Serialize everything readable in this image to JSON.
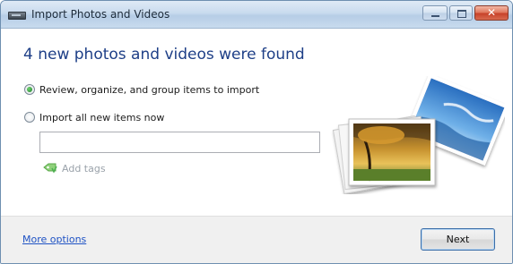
{
  "window": {
    "title": "Import Photos and Videos"
  },
  "main": {
    "heading": "4 new photos and videos were found",
    "options": [
      {
        "label": "Review, organize, and group items to import",
        "selected": true
      },
      {
        "label": "Import all new items now",
        "selected": false
      }
    ],
    "tag_input": {
      "value": "",
      "placeholder": ""
    },
    "add_tags_label": "Add tags"
  },
  "footer": {
    "more_options": "More options",
    "next_label": "Next"
  },
  "icons": {
    "app": "app-window-icon",
    "tag": "tag-icon",
    "photos": "photo-stack-illustration"
  },
  "colors": {
    "heading": "#1e3f87",
    "link": "#1e52c4",
    "footer_bg": "#f0f0f0",
    "close_button": "#c8432a"
  }
}
